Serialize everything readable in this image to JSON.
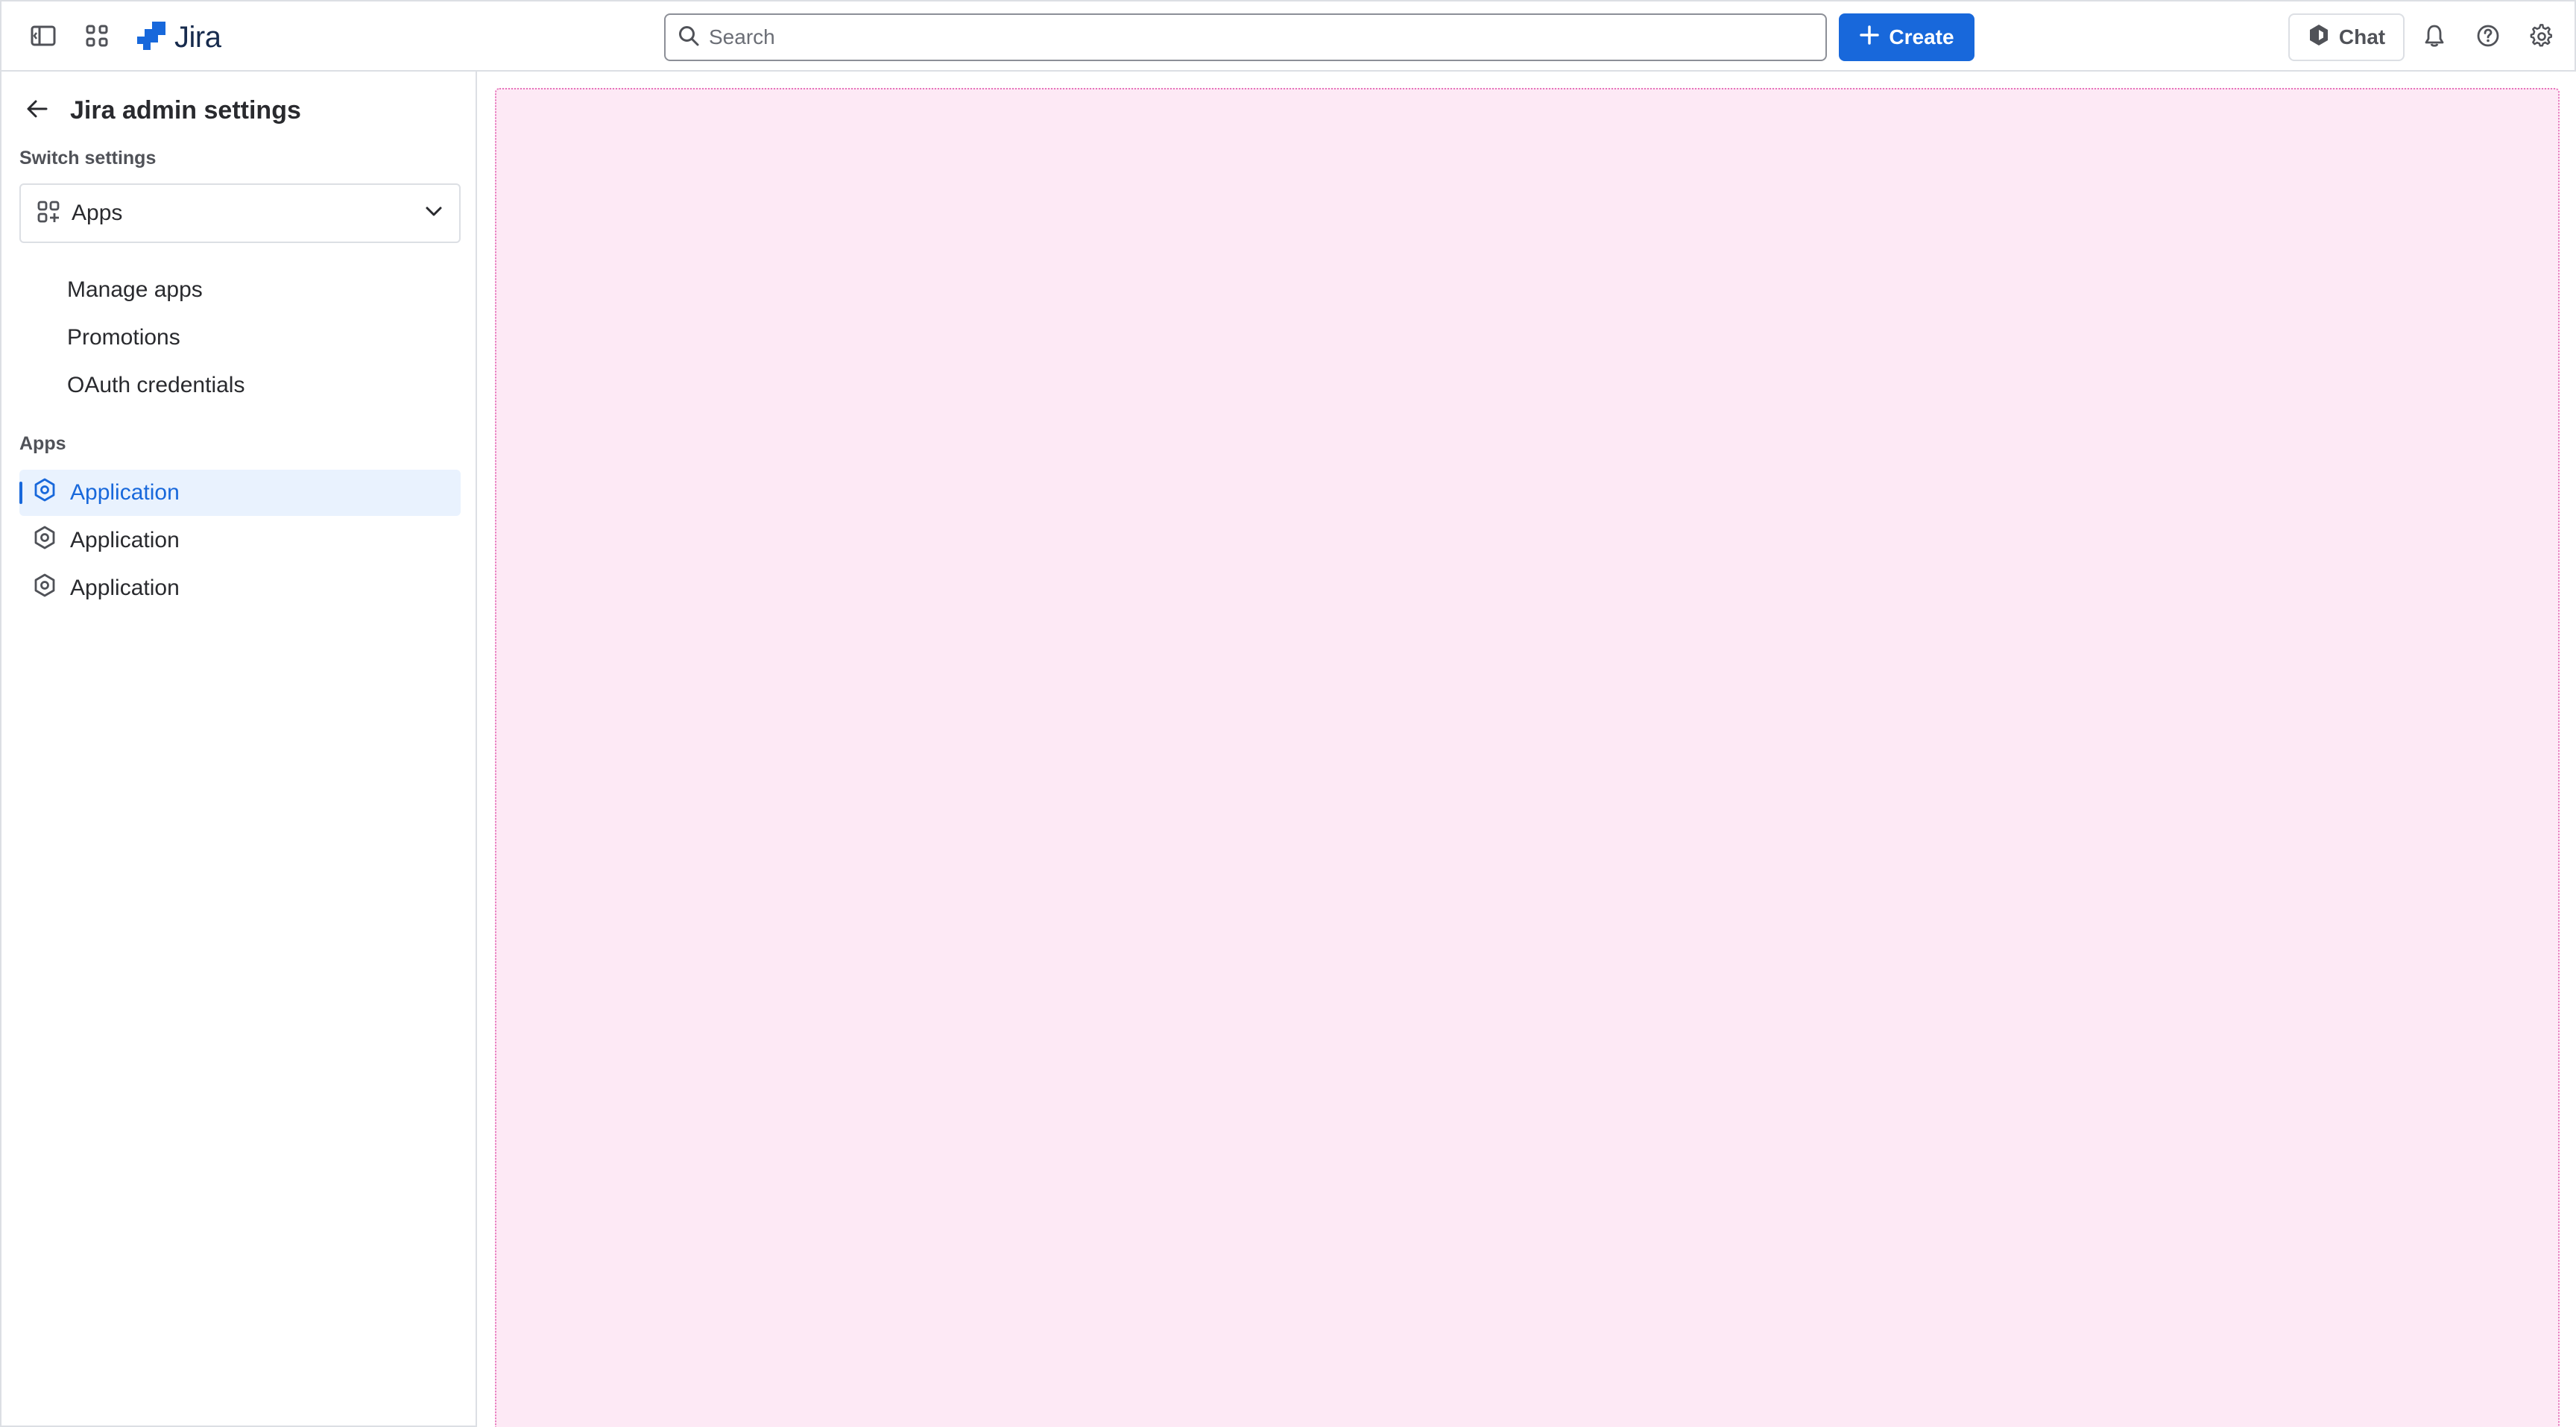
{
  "topbar": {
    "sidebar_toggle_icon": "sidebar-toggle-icon",
    "app_switcher_icon": "app-switcher-grid-icon",
    "logo_text": "Jira",
    "search_placeholder": "Search",
    "create_label": "Create",
    "chat_label": "Chat",
    "notifications_icon": "bell-icon",
    "help_icon": "help-icon",
    "settings_icon": "gear-icon"
  },
  "sidebar": {
    "title": "Jira admin settings",
    "switch_label": "Switch settings",
    "switch_value": "Apps",
    "links": [
      {
        "label": "Manage apps"
      },
      {
        "label": "Promotions"
      },
      {
        "label": "OAuth credentials"
      }
    ],
    "apps_label": "Apps",
    "apps": [
      {
        "label": "Application",
        "active": true
      },
      {
        "label": "Application",
        "active": false
      },
      {
        "label": "Application",
        "active": false
      }
    ]
  },
  "colors": {
    "brand": "#1868DB",
    "active_bg": "#E9F2FE",
    "content_placeholder": "#FDE9F5",
    "content_border": "#E774BB"
  }
}
